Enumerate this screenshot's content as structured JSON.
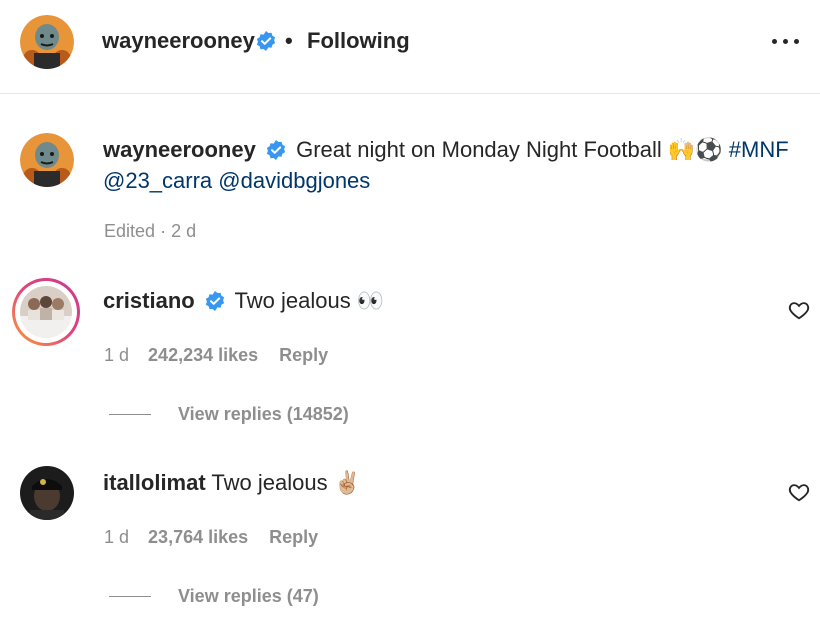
{
  "header": {
    "username": "wayneerooney",
    "separator": "•",
    "follow_status": "Following",
    "avatar_icon": "cartoon-avatar-icon",
    "more_icon": "more-options-icon"
  },
  "caption": {
    "username": "wayneerooney",
    "text": "Great night on Monday Night Football",
    "emojis": "🙌⚽",
    "hashtag": "#MNF",
    "mention_1": "@23_carra",
    "mention_2": "@davidbgjones",
    "edited": "Edited",
    "dot": "·",
    "age": "2 d"
  },
  "comments": [
    {
      "username": "cristiano",
      "verified": true,
      "text": "Two jealous",
      "emoji": "👀",
      "age": "1 d",
      "likes": "242,234 likes",
      "reply": "Reply",
      "view_replies": "View replies (14852)"
    },
    {
      "username": "itallolimat",
      "verified": false,
      "text": "Two jealous",
      "emoji": "✌🏼",
      "age": "1 d",
      "likes": "23,764 likes",
      "reply": "Reply",
      "view_replies": "View replies (47)"
    }
  ],
  "colors": {
    "text": "#262626",
    "secondary": "#8e8e8e",
    "link": "#00376b",
    "verified": "#3897f0"
  }
}
